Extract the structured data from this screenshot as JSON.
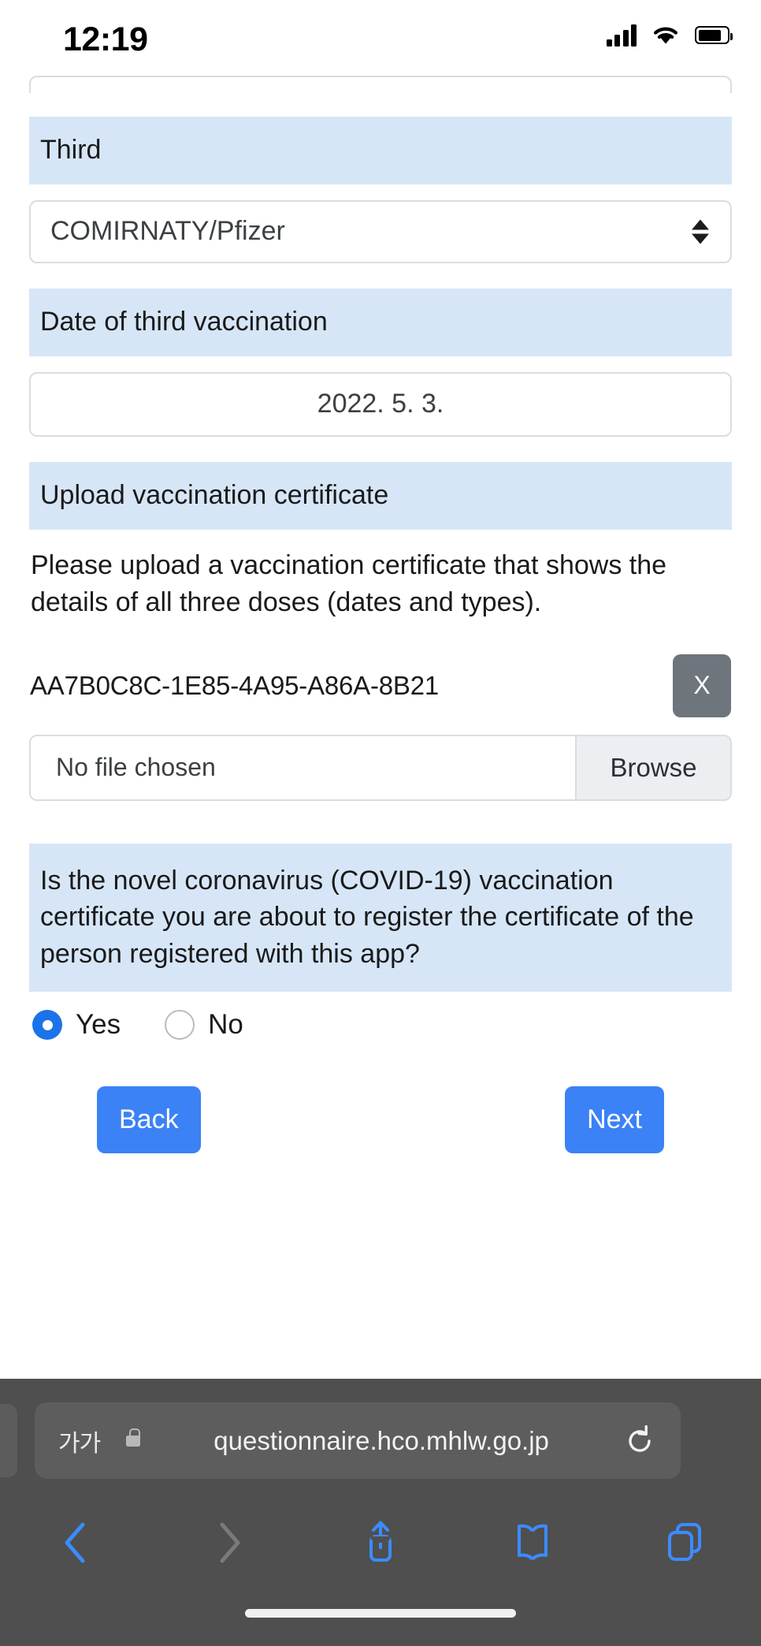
{
  "status_bar": {
    "time": "12:19",
    "signal_icon": "cellular-signal-icon",
    "wifi_icon": "wifi-icon",
    "battery_icon": "battery-icon"
  },
  "form": {
    "third_dose": {
      "label": "Third",
      "vaccine_select_value": "COMIRNATY/Pfizer",
      "select_icon": "updown-chevron-icon"
    },
    "third_date": {
      "label": "Date of third vaccination",
      "value": "2022. 5. 3."
    },
    "upload": {
      "label": "Upload vaccination certificate",
      "instructions": "Please upload a vaccination certificate that shows the details of all three doses (dates and types).",
      "uuid": "AA7B0C8C-1E85-4A95-A86A-8B21",
      "remove_label": "X",
      "file_placeholder": "No file chosen",
      "browse_label": "Browse"
    },
    "confirm_question": {
      "text": "Is the novel coronavirus (COVID-19) vaccination certificate you are about to register the certificate of the person registered with this app?",
      "options": [
        {
          "label": "Yes",
          "selected": true
        },
        {
          "label": "No",
          "selected": false
        }
      ]
    },
    "navigation": {
      "back_label": "Back",
      "next_label": "Next"
    }
  },
  "browser": {
    "text_size_label": "가가",
    "lock_icon": "lock-icon",
    "url": "questionnaire.hco.mhlw.go.jp",
    "reload_icon": "reload-icon",
    "toolbar": [
      {
        "name": "back-icon",
        "enabled": true
      },
      {
        "name": "forward-icon",
        "enabled": false
      },
      {
        "name": "share-icon",
        "enabled": true
      },
      {
        "name": "bookmarks-icon",
        "enabled": true
      },
      {
        "name": "tabs-icon",
        "enabled": true
      }
    ]
  },
  "colors": {
    "label_blue": "#d6e6f7",
    "button_blue": "#3b82f6",
    "radio_blue": "#1a73e8",
    "x_button_gray": "#6e757c",
    "safari_chrome": "#4f4f4f",
    "safari_tint": "#3b8cff"
  }
}
